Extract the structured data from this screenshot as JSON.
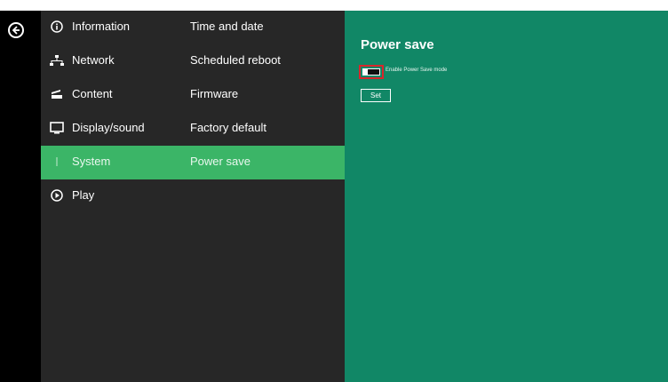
{
  "menu": {
    "rows": [
      {
        "label": "Information",
        "sub": "Time and date",
        "icon": "info-icon"
      },
      {
        "label": "Network",
        "sub": "Scheduled reboot",
        "icon": "network-icon"
      },
      {
        "label": "Content",
        "sub": "Firmware",
        "icon": "content-icon"
      },
      {
        "label": "Display/sound",
        "sub": "Factory default",
        "icon": "display-icon"
      },
      {
        "label": "System",
        "sub": "Power save",
        "icon": "system-icon",
        "active": true
      },
      {
        "label": "Play",
        "sub": "",
        "icon": "play-icon"
      }
    ]
  },
  "panel": {
    "title": "Power save",
    "toggle_label": "Enable Power Save mode",
    "toggle_on": false,
    "set_label": "Set"
  },
  "colors": {
    "menu_bg": "#272727",
    "active_bg": "#3bb567",
    "panel_bg": "#118766",
    "highlight": "#d9262b"
  },
  "icons": {
    "back": "back-arrow-icon"
  }
}
